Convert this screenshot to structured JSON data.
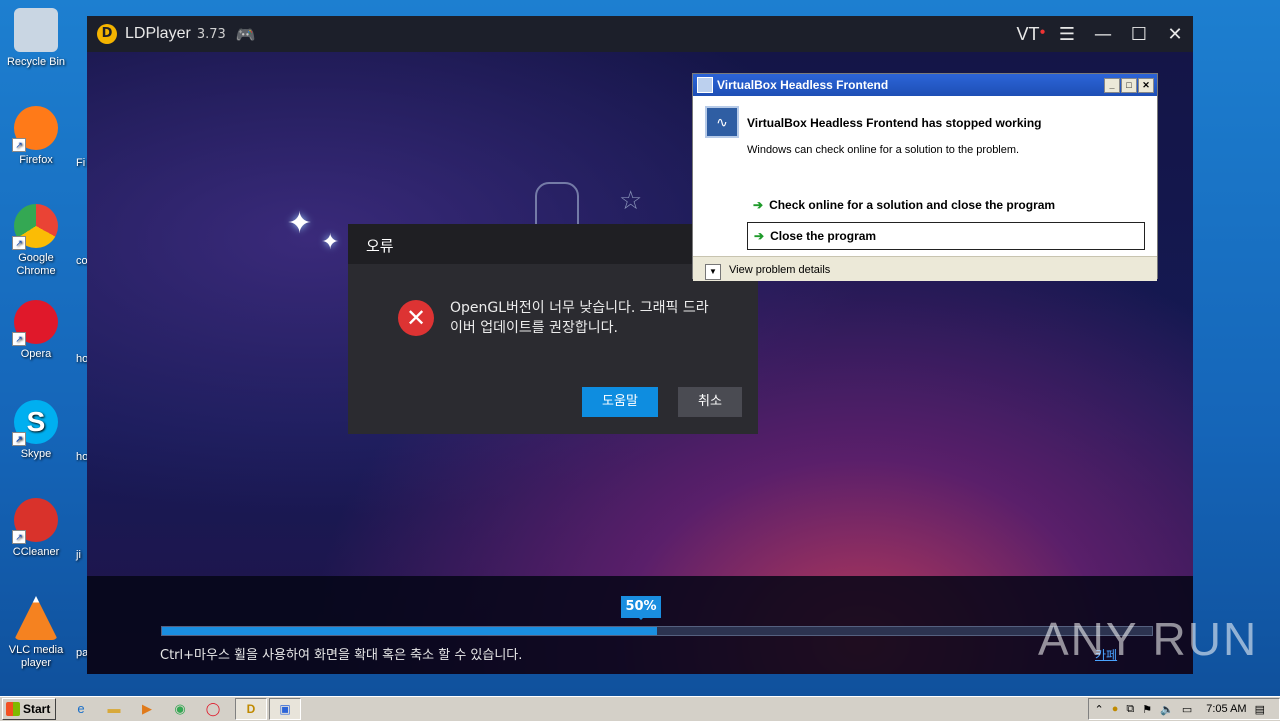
{
  "desktop": {
    "icons": [
      {
        "label": "Recycle Bin",
        "icon": "recycle-bin-icon",
        "color": "#c9d6e3"
      },
      {
        "label": "Firefox",
        "icon": "firefox-icon",
        "color": "#ff7a18"
      },
      {
        "label": "Google Chrome",
        "icon": "chrome-icon",
        "color": "#34a853"
      },
      {
        "label": "Opera",
        "icon": "opera-icon",
        "color": "#e0182a"
      },
      {
        "label": "Skype",
        "icon": "skype-icon",
        "color": "#00aff0"
      },
      {
        "label": "CCleaner",
        "icon": "ccleaner-icon",
        "color": "#d9322b"
      },
      {
        "label": "VLC media player",
        "icon": "vlc-icon",
        "color": "#f58220"
      }
    ],
    "side_letters": [
      "Fi",
      "co",
      "ho",
      "ho",
      "ji",
      "pa"
    ]
  },
  "ldplayer": {
    "title": "LDPlayer",
    "version": "3.73",
    "vt_label": "VT",
    "progress_label": "50%",
    "progress_value": 0.5,
    "hint": "Ctrl+마우스 휠을 사용하여 화면을 확대 혹은 축소 할 수 있습니다.",
    "cafe_link": "카페"
  },
  "error_dialog": {
    "title": "오류",
    "message": "OpenGL버전이 너무 낮습니다. 그래픽 드라이버 업데이트를 권장합니다.",
    "help_button": "도움말",
    "cancel_button": "취소"
  },
  "vbox_dialog": {
    "title": "VirtualBox Headless Frontend",
    "heading": "VirtualBox Headless Frontend has stopped working",
    "subtext": "Windows can check online for a solution to the problem.",
    "option_online": "Check online for a solution and close the program",
    "option_close": "Close the program",
    "details": "View problem details"
  },
  "watermark": "ANY RUN",
  "taskbar": {
    "start_label": "Start",
    "clock": "7:05 AM"
  },
  "colors": {
    "accent": "#1a8ee0",
    "error_red": "#d33333",
    "xp_blue": "#2c64d8"
  }
}
